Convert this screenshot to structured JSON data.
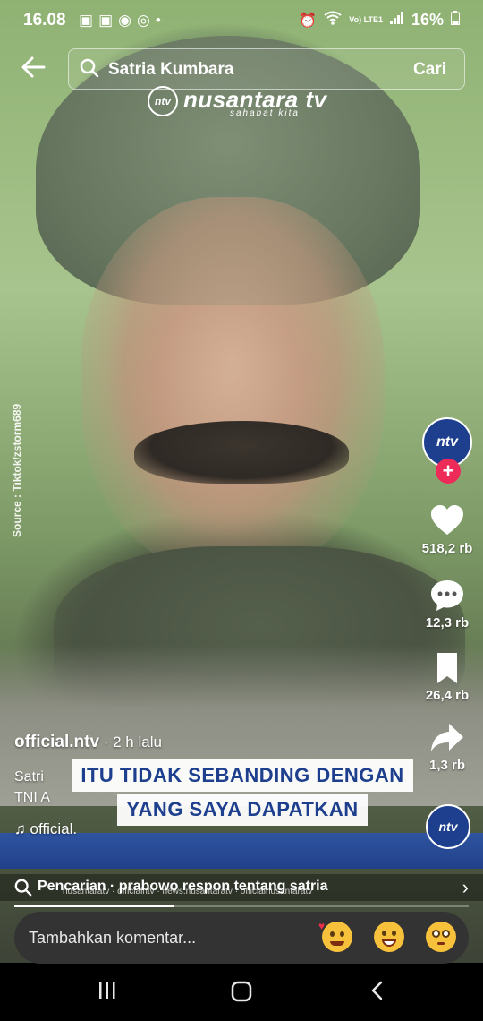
{
  "status_bar": {
    "time": "16.08",
    "left_icons": [
      "gallery-icon",
      "gallery-icon",
      "app-icon",
      "whatsapp-icon",
      "dot-icon"
    ],
    "lte_label": "Vo) LTE1",
    "battery": "16%"
  },
  "search": {
    "query": "Satria Kumbara",
    "action": "Cari"
  },
  "watermark": {
    "badge": "ntv",
    "brand": "nusantara tv",
    "tagline": "sahabat kita"
  },
  "source_note": "Source : Tiktok/zstorm689",
  "rail": {
    "avatar": "ntv",
    "follow": "+",
    "likes": "518,2 rb",
    "comments": "12,3 rb",
    "bookmarks": "26,4 rb",
    "shares": "1,3 rb"
  },
  "post": {
    "username": "official.ntv",
    "time": " · 2 h lalu",
    "description": "Satri",
    "description2": "TNI A",
    "sound": "official."
  },
  "subtitle": {
    "line1": "ITU TIDAK SEBANDING DENGAN",
    "line2": "YANG SAYA DAPATKAN"
  },
  "bottom_logo": "ntv",
  "credits": "nusantaratv  ·  officialntv  ·  news.nusantaratv  ·  officialnusantaratv",
  "suggestion": {
    "text": "Pencarian · prabowo respon tentang satria",
    "arrow": "›"
  },
  "progress": 0.35,
  "comment": {
    "placeholder": "Tambahkan komentar..."
  },
  "colors": {
    "brand_blue": "#1d3f8e",
    "follow_pink": "#ee2a59"
  }
}
